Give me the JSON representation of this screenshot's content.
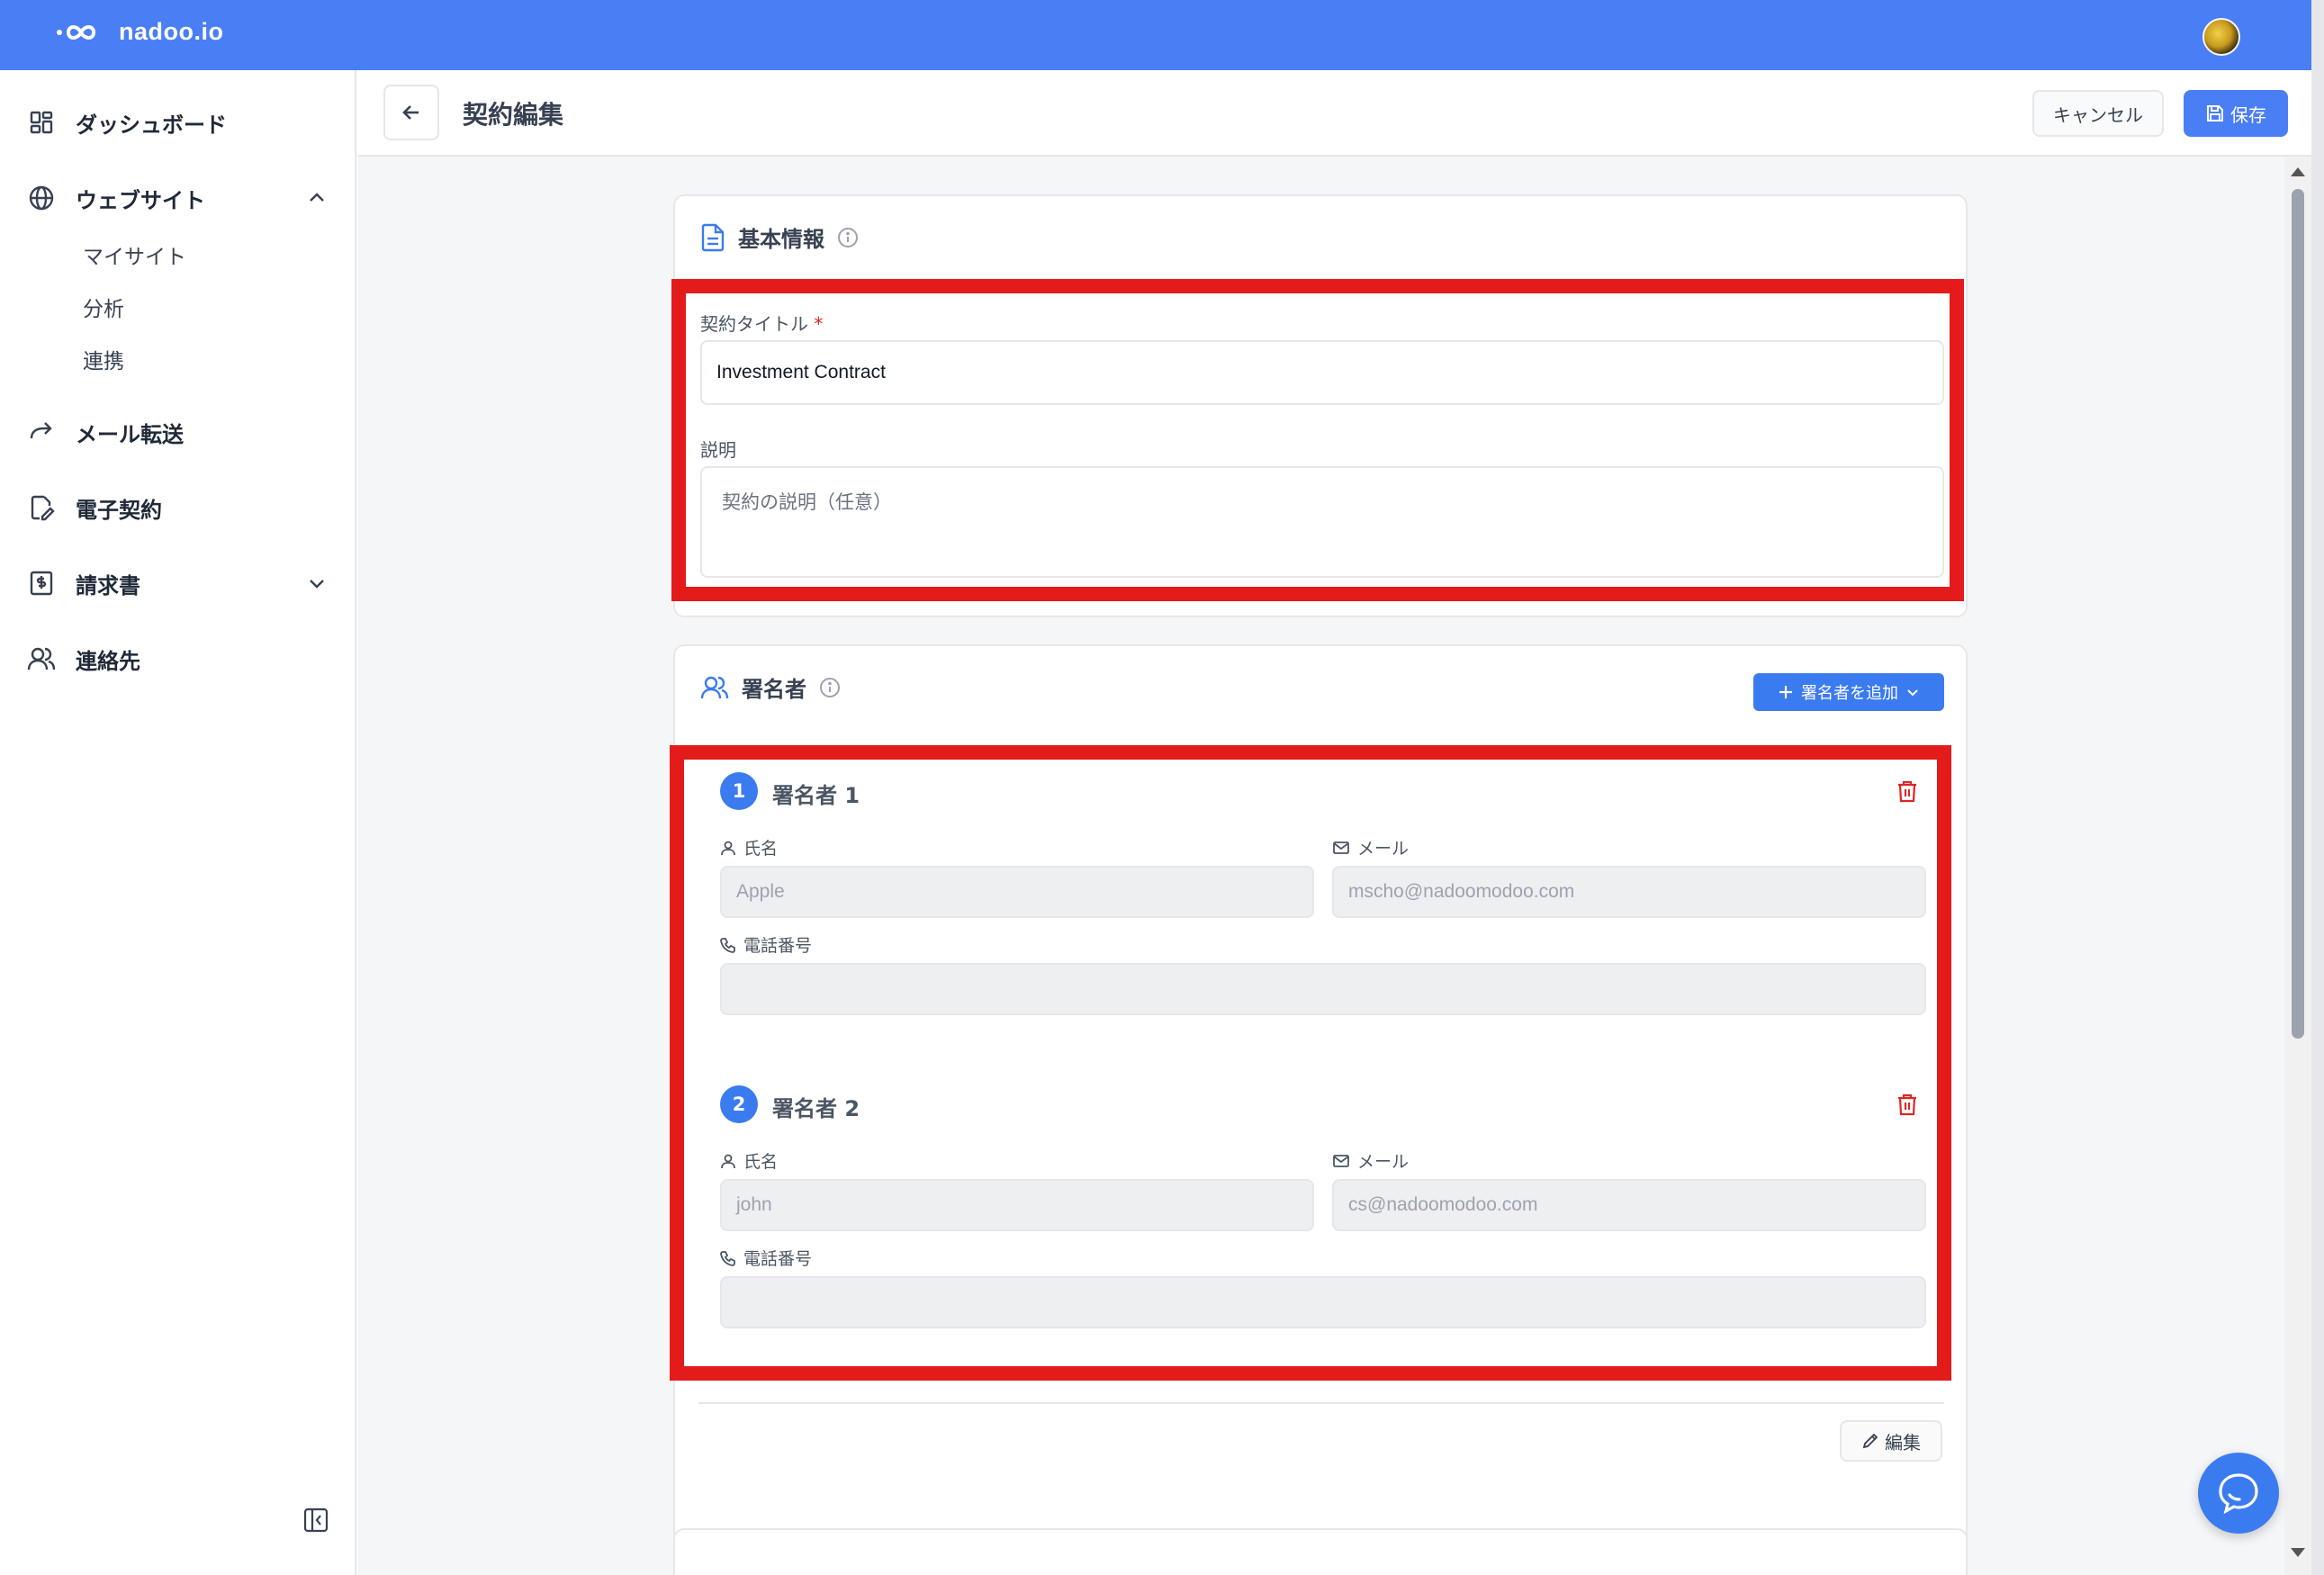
{
  "app": {
    "name": "nadoo.io"
  },
  "sidebar": {
    "items": [
      {
        "label": "ダッシュボード",
        "icon": "dashboard-icon"
      },
      {
        "label": "ウェブサイト",
        "icon": "globe-icon",
        "expanded": true,
        "children": [
          {
            "label": "マイサイト"
          },
          {
            "label": "分析"
          },
          {
            "label": "連携"
          }
        ]
      },
      {
        "label": "メール転送",
        "icon": "forward-arrow-icon"
      },
      {
        "label": "電子契約",
        "icon": "document-sign-icon"
      },
      {
        "label": "請求書",
        "icon": "invoice-icon",
        "expanded": false
      },
      {
        "label": "連絡先",
        "icon": "users-icon"
      }
    ]
  },
  "header": {
    "title": "契約編集",
    "cancel_label": "キャンセル",
    "save_label": "保存"
  },
  "basic_info": {
    "title": "基本情報",
    "contract_title_label": "契約タイトル",
    "required_mark": "*",
    "contract_title_value": "Investment Contract",
    "description_label": "説明",
    "description_placeholder": "契約の説明（任意）"
  },
  "signers": {
    "title": "署名者",
    "add_button_label": "署名者を追加",
    "edit_button_label": "編集",
    "list": [
      {
        "number": "1",
        "title": "署名者 1",
        "name_label": "氏名",
        "name_value": "Apple",
        "email_label": "メール",
        "email_value": "mscho@nadoomodoo.com",
        "phone_label": "電話番号",
        "phone_value": ""
      },
      {
        "number": "2",
        "title": "署名者 2",
        "name_label": "氏名",
        "name_value": "john",
        "email_label": "メール",
        "email_value": "cs@nadoomodoo.com",
        "phone_label": "電話番号",
        "phone_value": ""
      }
    ]
  },
  "colors": {
    "brand": "#4a7ef5",
    "highlight": "#e31b1b",
    "danger": "#dc2626"
  }
}
